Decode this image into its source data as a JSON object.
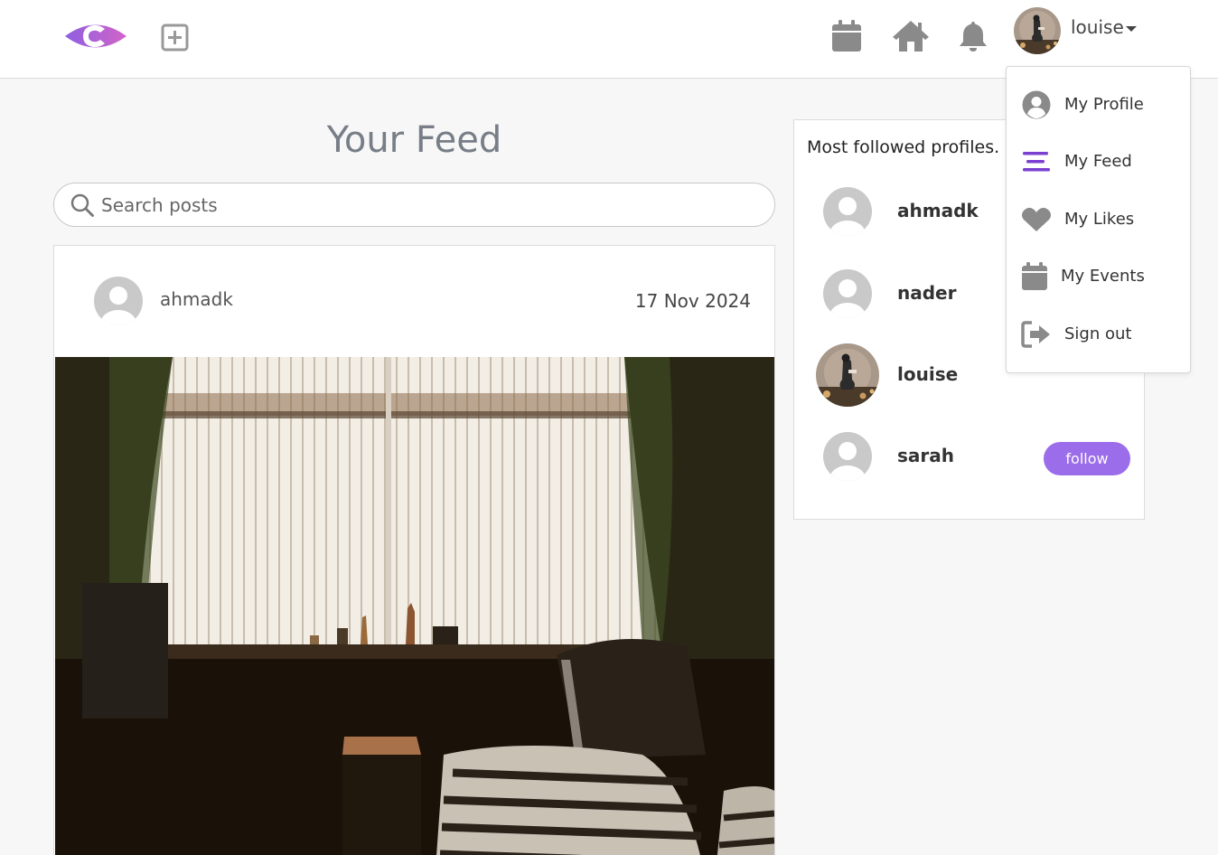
{
  "navbar": {
    "logo": "c-eye-logo",
    "add_post_icon": "plus-square-icon",
    "icons": [
      "calendar-icon",
      "home-icon",
      "bell-icon"
    ],
    "username": "louise"
  },
  "feed": {
    "title": "Your Feed",
    "search_placeholder": "Search posts",
    "search_value": ""
  },
  "post": {
    "author": "ahmadk",
    "date": "17 Nov 2024"
  },
  "profiles": {
    "title": "Most followed profiles.",
    "items": [
      {
        "name": "ahmadk"
      },
      {
        "name": "nader"
      },
      {
        "name": "louise"
      },
      {
        "name": "sarah",
        "button": "follow"
      }
    ]
  },
  "dropdown": {
    "items": [
      {
        "label": "My Profile",
        "icon": "user-circle-icon"
      },
      {
        "label": "My Feed",
        "icon": "stream-icon"
      },
      {
        "label": "My Likes",
        "icon": "heart-icon"
      },
      {
        "label": "My Events",
        "icon": "calendar-icon"
      },
      {
        "label": "Sign out",
        "icon": "sign-out-icon"
      }
    ]
  },
  "colors": {
    "accent": "#9b6dea",
    "icon_gray": "#8a8a8a",
    "feed_icon_purple": "#7b3fd1"
  }
}
